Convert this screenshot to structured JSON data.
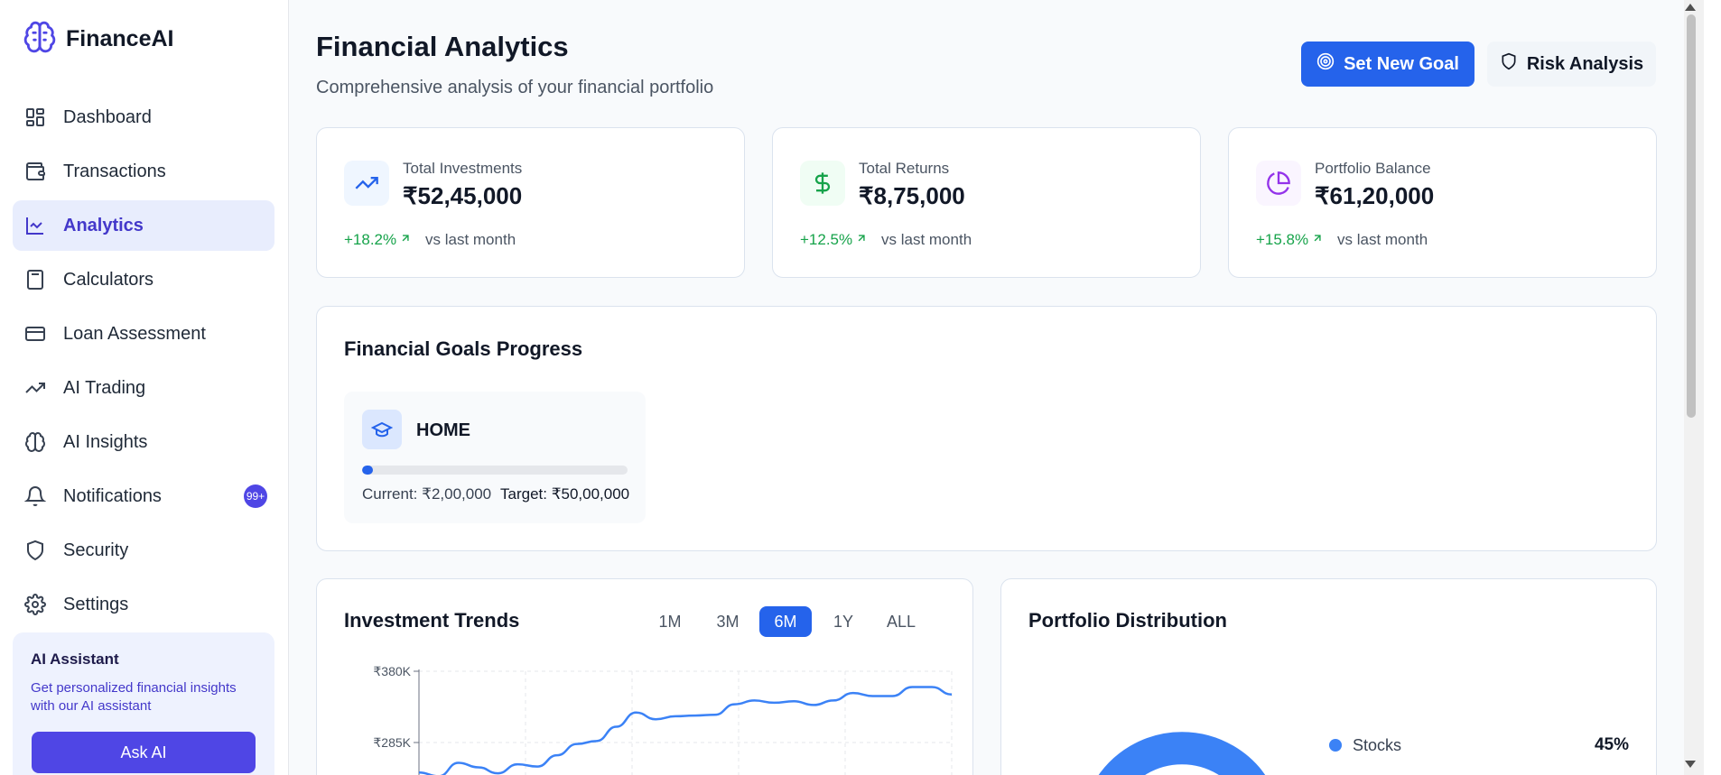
{
  "app": {
    "name": "FinanceAI"
  },
  "sidebar": {
    "items": [
      {
        "label": "Dashboard",
        "icon": "dashboard-icon"
      },
      {
        "label": "Transactions",
        "icon": "wallet-icon"
      },
      {
        "label": "Analytics",
        "icon": "line-chart-icon",
        "active": true
      },
      {
        "label": "Calculators",
        "icon": "calculator-icon"
      },
      {
        "label": "Loan Assessment",
        "icon": "credit-card-icon"
      },
      {
        "label": "AI Trading",
        "icon": "trending-up-icon"
      },
      {
        "label": "AI Insights",
        "icon": "brain-icon"
      },
      {
        "label": "Notifications",
        "icon": "bell-icon",
        "badge": "99+"
      },
      {
        "label": "Security",
        "icon": "shield-icon"
      },
      {
        "label": "Settings",
        "icon": "gear-icon"
      }
    ],
    "ai_card": {
      "title": "AI Assistant",
      "description": "Get personalized financial insights with our AI assistant",
      "button": "Ask AI"
    }
  },
  "header": {
    "title": "Financial Analytics",
    "subtitle": "Comprehensive analysis of your financial portfolio",
    "primary_button": "Set New Goal",
    "secondary_button": "Risk Analysis"
  },
  "stats": [
    {
      "label": "Total Investments",
      "value": "₹52,45,000",
      "change": "+18.2%",
      "vs": "vs last month",
      "icon": "trending-up-icon",
      "color": "#2563eb",
      "bg": "#eff6ff"
    },
    {
      "label": "Total Returns",
      "value": "₹8,75,000",
      "change": "+12.5%",
      "vs": "vs last month",
      "icon": "dollar-icon",
      "color": "#16a34a",
      "bg": "#f0fdf4"
    },
    {
      "label": "Portfolio Balance",
      "value": "₹61,20,000",
      "change": "+15.8%",
      "vs": "vs last month",
      "icon": "pie-chart-icon",
      "color": "#9333ea",
      "bg": "#faf5ff"
    }
  ],
  "goals": {
    "title": "Financial Goals Progress",
    "items": [
      {
        "name": "HOME",
        "current": "Current: ₹2,00,000",
        "target": "Target: ₹50,00,000",
        "progress": 0.04,
        "icon": "graduation-cap-icon"
      }
    ]
  },
  "trends": {
    "title": "Investment Trends",
    "ranges": [
      "1M",
      "3M",
      "6M",
      "1Y",
      "ALL"
    ],
    "active_range": "6M"
  },
  "distribution": {
    "title": "Portfolio Distribution",
    "legend": [
      {
        "label": "Stocks",
        "value": "45%",
        "color": "#3b82f6"
      }
    ]
  },
  "chart_data": {
    "type": "line",
    "title": "",
    "xlabel": "",
    "ylabel": "",
    "y_ticks": [
      "₹380K",
      "₹285K"
    ],
    "ylim": [
      190000,
      380000
    ],
    "series": [
      {
        "values": [
          245000,
          240000,
          258000,
          252000,
          244000,
          256000,
          253000,
          268000,
          283000,
          287000,
          306000,
          325000,
          316000,
          320000,
          321000,
          322000,
          336000,
          341000,
          338000,
          340000,
          335000,
          341000,
          351000,
          347000,
          347000,
          359000,
          359000,
          349000
        ]
      }
    ],
    "grid": true,
    "color": "#3b82f6"
  }
}
